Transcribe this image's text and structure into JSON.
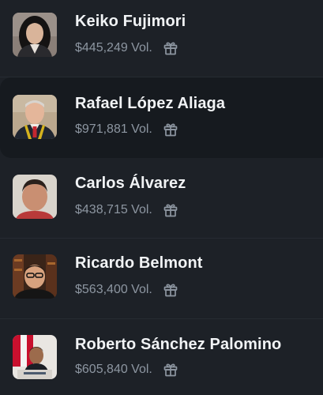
{
  "candidates": [
    {
      "name": "Keiko Fujimori",
      "volume": "$445,249 Vol.",
      "icon": "gift-icon"
    },
    {
      "name": "Rafael López Aliaga",
      "volume": "$971,881 Vol.",
      "icon": "gift-icon"
    },
    {
      "name": "Carlos Álvarez",
      "volume": "$438,715 Vol.",
      "icon": "gift-icon"
    },
    {
      "name": "Ricardo Belmont",
      "volume": "$563,400 Vol.",
      "icon": "gift-icon"
    },
    {
      "name": "Roberto Sánchez Palomino",
      "volume": "$605,840 Vol.",
      "icon": "gift-icon"
    }
  ],
  "colors": {
    "background": "#1d2127",
    "highlighted_row": "#161a1f",
    "name_text": "#f1f3f5",
    "volume_text": "#8d96a1"
  }
}
